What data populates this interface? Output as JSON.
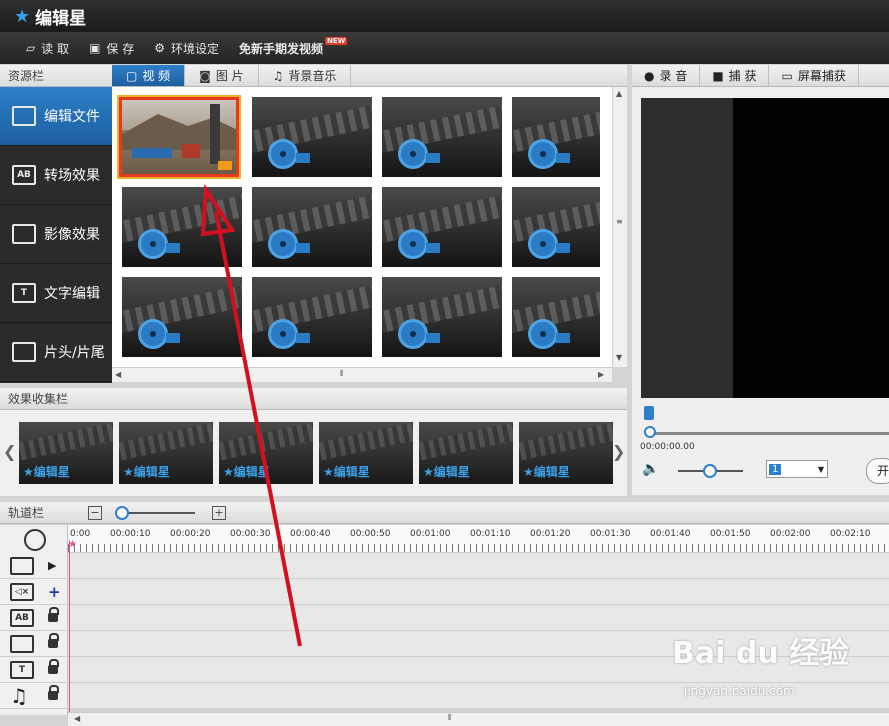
{
  "app": {
    "title": "编辑星"
  },
  "menu": {
    "items": [
      "读 取",
      "保 存",
      "环境设定",
      "免新手期发视频"
    ],
    "new_badge": "NEW"
  },
  "resource_panel": {
    "label": "资源栏",
    "tabs": [
      "视 频",
      "图 片",
      "背景音乐"
    ]
  },
  "sidebar": {
    "items": [
      {
        "label": "编辑文件",
        "icon": "film-icon",
        "active": true
      },
      {
        "label": "转场效果",
        "icon": "ab-icon",
        "active": false
      },
      {
        "label": "影像效果",
        "icon": "image-effect-icon",
        "active": false
      },
      {
        "label": "文字编辑",
        "icon": "text-icon",
        "active": false
      },
      {
        "label": "片头/片尾",
        "icon": "header-footer-icon",
        "active": false
      }
    ]
  },
  "right_tabs": [
    "录 音",
    "捕 获",
    "屏幕捕获"
  ],
  "collect": {
    "label": "效果收集栏",
    "watermark": "编辑星",
    "count": 6
  },
  "player": {
    "time": "00:00:00.00",
    "speed_value": "1",
    "open_label": "开"
  },
  "track": {
    "label": "轨道栏",
    "minus": "−",
    "plus": "+",
    "ruler": [
      "0:00",
      "00:00:10",
      "00:00:20",
      "00:00:30",
      "00:00:40",
      "00:00:50",
      "00:01:00",
      "00:01:10",
      "00:01:20",
      "00:01:30",
      "00:01:40",
      "00:01:50",
      "00:02:00",
      "00:02:10"
    ]
  },
  "watermark": {
    "logo": "Bai du 经验",
    "url": "jingyan.baidu.com"
  },
  "accent": "#2d7fc8",
  "annotation_color": "#d41020"
}
